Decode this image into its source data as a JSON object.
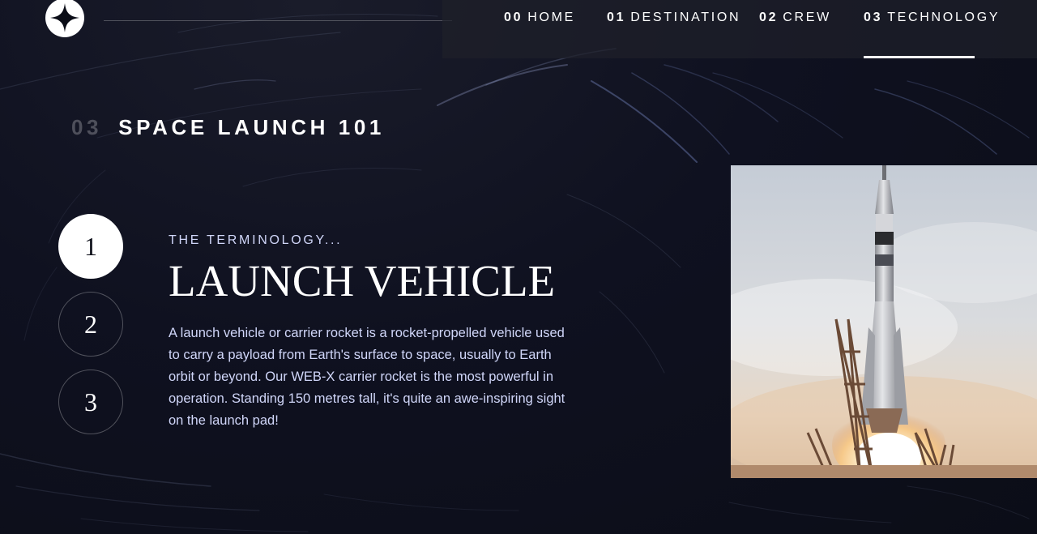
{
  "header": {
    "logo_name": "star-logo-icon",
    "nav": [
      {
        "num": "00",
        "label": "HOME",
        "active": false
      },
      {
        "num": "01",
        "label": "DESTINATION",
        "active": false
      },
      {
        "num": "02",
        "label": "CREW",
        "active": false
      },
      {
        "num": "03",
        "label": "TECHNOLOGY",
        "active": true
      }
    ]
  },
  "page": {
    "number": "03",
    "title": "SPACE LAUNCH 101"
  },
  "steps": [
    "1",
    "2",
    "3"
  ],
  "active_step": "1",
  "content": {
    "subheading": "THE TERMINOLOGY...",
    "title": "LAUNCH VEHICLE",
    "description": "A launch vehicle or carrier rocket is a rocket-propelled vehicle used to carry a payload from Earth's surface to space, usually to Earth orbit or beyond. Our WEB-X carrier rocket is the most powerful in operation. Standing 150 metres tall, it's quite an awe-inspiring sight on the launch pad!"
  },
  "colors": {
    "background": "#0b0d17",
    "accent_text": "#d0d6f9",
    "white": "#ffffff"
  }
}
